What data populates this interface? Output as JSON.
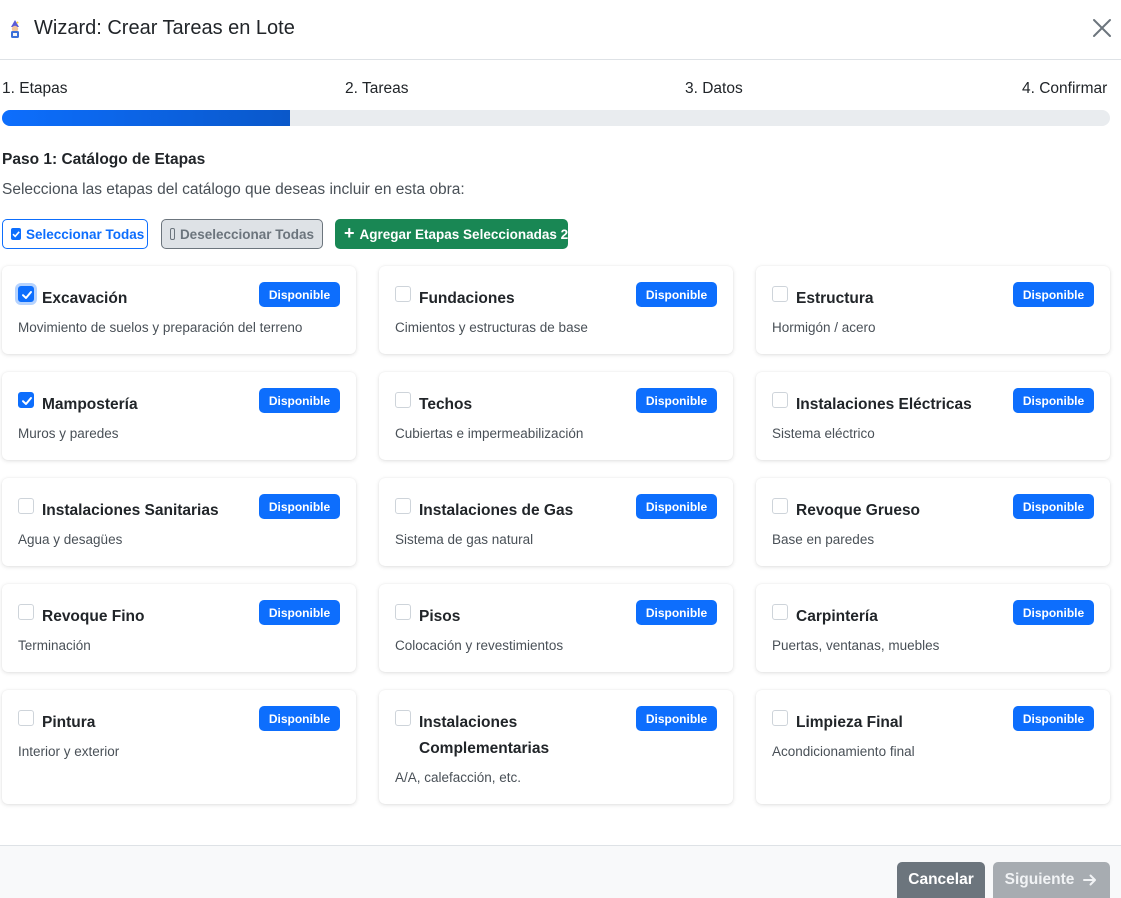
{
  "header": {
    "title": "Wizard: Crear Tareas en Lote",
    "icon": "wizard-icon",
    "close_icon": "close-icon"
  },
  "steps": [
    {
      "label": "1. Etapas"
    },
    {
      "label": "2. Tareas"
    },
    {
      "label": "3. Datos"
    },
    {
      "label": "4. Confirmar"
    }
  ],
  "progress": {
    "fraction": 0.25
  },
  "step1": {
    "heading": "Paso 1: Catálogo de Etapas",
    "description": "Selecciona las etapas del catálogo que deseas incluir en esta obra:"
  },
  "actions": {
    "select_all": "Seleccionar Todas",
    "deselect_all": "Deseleccionar Todas",
    "add_selected": "Agregar Etapas Seleccionadas 2"
  },
  "stages": [
    {
      "title": "Excavación",
      "badge": "Disponible",
      "desc": "Movimiento de suelos y preparación del terreno",
      "checked": true
    },
    {
      "title": "Fundaciones",
      "badge": "Disponible",
      "desc": "Cimientos y estructuras de base",
      "checked": false
    },
    {
      "title": "Estructura",
      "badge": "Disponible",
      "desc": "Hormigón / acero",
      "checked": false
    },
    {
      "title": "Mampostería",
      "badge": "Disponible",
      "desc": "Muros y paredes",
      "checked": true
    },
    {
      "title": "Techos",
      "badge": "Disponible",
      "desc": "Cubiertas e impermeabilización",
      "checked": false
    },
    {
      "title": "Instalaciones Eléctricas",
      "badge": "Disponible",
      "desc": "Sistema eléctrico",
      "checked": false
    },
    {
      "title": "Instalaciones Sanitarias",
      "badge": "Disponible",
      "desc": "Agua y desagües",
      "checked": false
    },
    {
      "title": "Instalaciones de Gas",
      "badge": "Disponible",
      "desc": "Sistema de gas natural",
      "checked": false
    },
    {
      "title": "Revoque Grueso",
      "badge": "Disponible",
      "desc": "Base en paredes",
      "checked": false
    },
    {
      "title": "Revoque Fino",
      "badge": "Disponible",
      "desc": "Terminación",
      "checked": false
    },
    {
      "title": "Pisos",
      "badge": "Disponible",
      "desc": "Colocación y revestimientos",
      "checked": false
    },
    {
      "title": "Carpintería",
      "badge": "Disponible",
      "desc": "Puertas, ventanas, muebles",
      "checked": false
    },
    {
      "title": "Pintura",
      "badge": "Disponible",
      "desc": "Interior y exterior",
      "checked": false
    },
    {
      "title": "Instalaciones Complementarias",
      "badge": "Disponible",
      "desc": "A/A, calefacción, etc.",
      "checked": false
    },
    {
      "title": "Limpieza Final",
      "badge": "Disponible",
      "desc": "Acondicionamiento final",
      "checked": false
    }
  ],
  "footer": {
    "cancel": "Cancelar",
    "next": "Siguiente",
    "next_icon": "arrow-right-icon"
  },
  "colors": {
    "primary": "#0d6efd",
    "success": "#198754",
    "secondary": "#6c757d"
  }
}
